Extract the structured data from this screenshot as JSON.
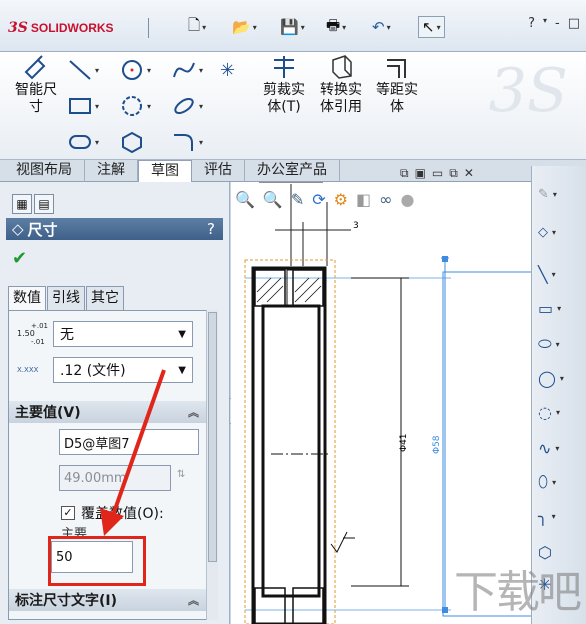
{
  "app": {
    "logo_mark": "3S",
    "logo_text": "SOLIDWORKS"
  },
  "titlebar": {
    "controls": [
      "?",
      "-",
      "□"
    ]
  },
  "ribbon": {
    "smart_dim": "智能尺寸",
    "trim": "剪裁实体(T)",
    "convert": "转换实体引用",
    "offset": "等距实体"
  },
  "tabs": [
    {
      "label": "视图布局"
    },
    {
      "label": "注解"
    },
    {
      "label": "草图"
    },
    {
      "label": "评估"
    },
    {
      "label": "办公室产品"
    }
  ],
  "pm": {
    "title": "尺寸",
    "help": "?",
    "subtabs": [
      "数值",
      "引线",
      "其它"
    ],
    "tol_top": "1.50",
    "tol_sup": "+.01",
    "tol_sub": "-.01",
    "tol_select": "无",
    "prec_ico": "X.XXX",
    "prec_select": ".12 (文件)",
    "primary_header": "主要值(V)",
    "primary_name": "D5@草图7",
    "primary_value": "49.00mm",
    "override_label": "覆盖数值(O):",
    "override_sub": "主要",
    "override_value": "50",
    "text_header": "标注尺寸文字(I)"
  },
  "canvas": {
    "dim_left": "Φ41",
    "dim_right": "Φ58",
    "dim_top": "3"
  },
  "watermark": "下载吧"
}
